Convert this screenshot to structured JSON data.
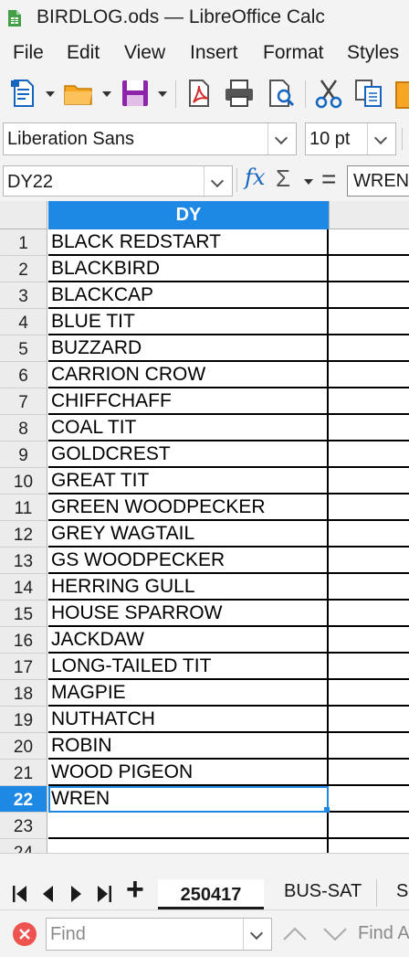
{
  "window": {
    "title": "BIRDLOG.ods — LibreOffice Calc",
    "icon": "calc-spreadsheet-icon"
  },
  "menubar": {
    "items": [
      "File",
      "Edit",
      "View",
      "Insert",
      "Format",
      "Styles"
    ]
  },
  "toolbar": {
    "icons": [
      "new-document-icon",
      "open-folder-icon",
      "save-icon",
      "export-pdf-icon",
      "print-icon",
      "print-preview-icon",
      "cut-icon",
      "copy-icon",
      "paste-icon"
    ]
  },
  "format_bar": {
    "font_name": "Liberation Sans",
    "font_size": "10 pt"
  },
  "formula_bar": {
    "name_box": "DY22",
    "function_wizard_label": "fx",
    "sum_symbol": "Σ",
    "equals_symbol": "=",
    "content": "WREN"
  },
  "sheet": {
    "active_column": "DY",
    "selected_row": "22",
    "rows": [
      {
        "num": "1",
        "value": "BLACK REDSTART"
      },
      {
        "num": "2",
        "value": "BLACKBIRD"
      },
      {
        "num": "3",
        "value": "BLACKCAP"
      },
      {
        "num": "4",
        "value": "BLUE TIT"
      },
      {
        "num": "5",
        "value": "BUZZARD"
      },
      {
        "num": "6",
        "value": "CARRION CROW"
      },
      {
        "num": "7",
        "value": "CHIFFCHAFF"
      },
      {
        "num": "8",
        "value": "COAL TIT"
      },
      {
        "num": "9",
        "value": "GOLDCREST"
      },
      {
        "num": "10",
        "value": "GREAT TIT"
      },
      {
        "num": "11",
        "value": "GREEN WOODPECKER"
      },
      {
        "num": "12",
        "value": "GREY WAGTAIL"
      },
      {
        "num": "13",
        "value": "GS WOODPECKER"
      },
      {
        "num": "14",
        "value": "HERRING GULL"
      },
      {
        "num": "15",
        "value": "HOUSE SPARROW"
      },
      {
        "num": "16",
        "value": "JACKDAW"
      },
      {
        "num": "17",
        "value": "LONG-TAILED TIT"
      },
      {
        "num": "18",
        "value": "MAGPIE"
      },
      {
        "num": "19",
        "value": "NUTHATCH"
      },
      {
        "num": "20",
        "value": "ROBIN"
      },
      {
        "num": "21",
        "value": "WOOD PIGEON"
      },
      {
        "num": "22",
        "value": "WREN"
      },
      {
        "num": "23",
        "value": ""
      },
      {
        "num": "24",
        "value": ""
      }
    ]
  },
  "tabs": {
    "add_symbol": "+",
    "active": "250417",
    "others": [
      "BUS-SAT",
      "S"
    ]
  },
  "find_bar": {
    "placeholder": "Find",
    "find_all_label": "Find A"
  },
  "colors": {
    "accent": "#1e88e5",
    "chrome": "#f3f3f3",
    "header_bg": "#ececec"
  }
}
